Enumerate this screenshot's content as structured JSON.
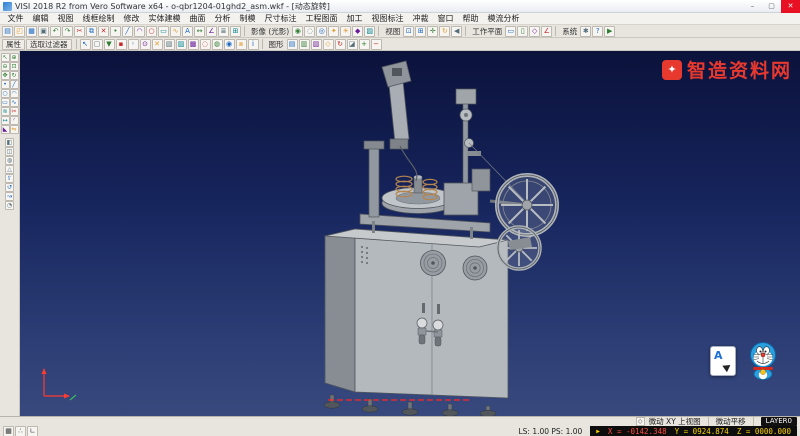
{
  "window": {
    "title": "VISI 2018 R2 from Vero Software x64 - o-qbr1204-01ghd2_asm.wkf - [动态旋转]",
    "controls": {
      "minimize": "–",
      "maximize": "▢",
      "close": "✕"
    }
  },
  "menu": {
    "items": [
      {
        "id": "file",
        "label": "文件"
      },
      {
        "id": "edit",
        "label": "编辑"
      },
      {
        "id": "view",
        "label": "视图"
      },
      {
        "id": "wireframe",
        "label": "线框绘制"
      },
      {
        "id": "modify",
        "label": "修改"
      },
      {
        "id": "solid",
        "label": "实体建模"
      },
      {
        "id": "surface",
        "label": "曲面"
      },
      {
        "id": "analysis",
        "label": "分析"
      },
      {
        "id": "mould",
        "label": "制模"
      },
      {
        "id": "dimension",
        "label": "尺寸标注"
      },
      {
        "id": "drawing",
        "label": "工程图面"
      },
      {
        "id": "machining",
        "label": "加工"
      },
      {
        "id": "view-annotation",
        "label": "视图标注"
      },
      {
        "id": "blanking",
        "label": "冲裁"
      },
      {
        "id": "window",
        "label": "窗口"
      },
      {
        "id": "help",
        "label": "帮助"
      },
      {
        "id": "flow-analysis",
        "label": "模流分析"
      }
    ]
  },
  "toolbar_main": {
    "icons": [
      {
        "name": "new-file",
        "glyph": "▤",
        "fg": "#1565c0"
      },
      {
        "name": "open-file",
        "glyph": "◰",
        "fg": "#e09a2f"
      },
      {
        "name": "save-file",
        "glyph": "▦",
        "fg": "#1565c0"
      },
      {
        "name": "print",
        "glyph": "▣",
        "fg": "#546e7a"
      },
      {
        "name": "undo",
        "glyph": "↶",
        "fg": "#2e7d32"
      },
      {
        "name": "redo",
        "glyph": "↷",
        "fg": "#2e7d32"
      },
      {
        "name": "cut",
        "glyph": "✂",
        "fg": "#c62828"
      },
      {
        "name": "copy",
        "glyph": "⧉",
        "fg": "#1565c0"
      },
      {
        "name": "delete",
        "glyph": "✕",
        "fg": "#c62828"
      },
      {
        "name": "point",
        "glyph": "•",
        "fg": "#2e7d32"
      },
      {
        "name": "line",
        "glyph": "╱",
        "fg": "#1565c0"
      },
      {
        "name": "arc",
        "glyph": "◠",
        "fg": "#6a1b9a"
      },
      {
        "name": "circle",
        "glyph": "○",
        "fg": "#c62828"
      },
      {
        "name": "rectangle",
        "glyph": "▭",
        "fg": "#00838f"
      },
      {
        "name": "curve",
        "glyph": "∿",
        "fg": "#e09a2f"
      },
      {
        "name": "text",
        "glyph": "A",
        "fg": "#1565c0"
      },
      {
        "name": "dimension",
        "glyph": "↔",
        "fg": "#2e7d32"
      },
      {
        "name": "angle-measure",
        "glyph": "∠",
        "fg": "#6a1b9a"
      },
      {
        "name": "layers",
        "glyph": "≣",
        "fg": "#546e7a"
      },
      {
        "name": "grid",
        "glyph": "⊞",
        "fg": "#00838f"
      }
    ],
    "groups": [
      {
        "id": "shading",
        "label": "影像 (光影)",
        "icons": [
          {
            "name": "shaded-view",
            "glyph": "◉",
            "fg": "#2e7d32"
          },
          {
            "name": "wireframe-view",
            "glyph": "◌",
            "fg": "#546e7a"
          },
          {
            "name": "hidden-line-view",
            "glyph": "◎",
            "fg": "#1565c0"
          },
          {
            "name": "render",
            "glyph": "✦",
            "fg": "#e09a2f"
          },
          {
            "name": "lighting",
            "glyph": "☀",
            "fg": "#e09a2f"
          },
          {
            "name": "materials",
            "glyph": "◆",
            "fg": "#6a1b9a"
          },
          {
            "name": "transparency",
            "glyph": "▨",
            "fg": "#00838f"
          }
        ]
      },
      {
        "id": "view",
        "label": "视图",
        "icons": [
          {
            "name": "zoom-fit",
            "glyph": "⊡",
            "fg": "#1565c0"
          },
          {
            "name": "zoom-window",
            "glyph": "⊞",
            "fg": "#1565c0"
          },
          {
            "name": "pan",
            "glyph": "✛",
            "fg": "#2e7d32"
          },
          {
            "name": "rotate-view",
            "glyph": "↻",
            "fg": "#e09a2f"
          },
          {
            "name": "previous-view",
            "glyph": "◀",
            "fg": "#546e7a"
          }
        ]
      },
      {
        "id": "workplane",
        "label": "工作平面",
        "icons": [
          {
            "name": "workplane-xy",
            "glyph": "▭",
            "fg": "#1565c0"
          },
          {
            "name": "workplane-yz",
            "glyph": "▯",
            "fg": "#2e7d32"
          },
          {
            "name": "workplane-iso",
            "glyph": "◇",
            "fg": "#6a1b9a"
          },
          {
            "name": "workplane-custom",
            "glyph": "∠",
            "fg": "#c62828"
          }
        ]
      },
      {
        "id": "system",
        "label": "系统",
        "icons": [
          {
            "name": "settings",
            "glyph": "✱",
            "fg": "#546e7a"
          },
          {
            "name": "help",
            "glyph": "?",
            "fg": "#1565c0"
          },
          {
            "name": "macro-run",
            "glyph": "▶",
            "fg": "#2e7d32"
          }
        ]
      }
    ]
  },
  "toolbar_second": {
    "left_labels": [
      "属性",
      "选取过滤器"
    ],
    "icons": [
      {
        "name": "select",
        "glyph": "↖",
        "fg": "#1565c0"
      },
      {
        "name": "select-window",
        "glyph": "▢",
        "fg": "#546e7a"
      },
      {
        "name": "selection-filter",
        "glyph": "▼",
        "fg": "#2e7d32"
      },
      {
        "name": "snap-endpoint",
        "glyph": "▪",
        "fg": "#c62828"
      },
      {
        "name": "snap-midpoint",
        "glyph": "◦",
        "fg": "#1565c0"
      },
      {
        "name": "snap-center",
        "glyph": "⊙",
        "fg": "#6a1b9a"
      },
      {
        "name": "snap-intersection",
        "glyph": "✕",
        "fg": "#e09a2f"
      },
      {
        "name": "filter-solids",
        "glyph": "▧",
        "fg": "#546e7a"
      },
      {
        "name": "filter-surfaces",
        "glyph": "▨",
        "fg": "#00838f"
      },
      {
        "name": "filter-wireframe",
        "glyph": "▩",
        "fg": "#6a1b9a"
      },
      {
        "name": "hide-entity",
        "glyph": "◌",
        "fg": "#c62828"
      },
      {
        "name": "show-all",
        "glyph": "◍",
        "fg": "#2e7d32"
      },
      {
        "name": "isolate",
        "glyph": "◉",
        "fg": "#1565c0"
      },
      {
        "name": "group-entities",
        "glyph": "⧈",
        "fg": "#e09a2f"
      },
      {
        "name": "entity-properties",
        "glyph": "i",
        "fg": "#1565c0"
      }
    ],
    "group_label": "图形",
    "icons2": [
      {
        "name": "view-top",
        "glyph": "▤",
        "fg": "#1565c0"
      },
      {
        "name": "view-front",
        "glyph": "▥",
        "fg": "#2e7d32"
      },
      {
        "name": "view-side",
        "glyph": "▨",
        "fg": "#6a1b9a"
      },
      {
        "name": "view-isometric",
        "glyph": "◇",
        "fg": "#e09a2f"
      },
      {
        "name": "dynamic-rotate",
        "glyph": "↻",
        "fg": "#c62828"
      },
      {
        "name": "section-view",
        "glyph": "◪",
        "fg": "#546e7a"
      },
      {
        "name": "zoom-in",
        "glyph": "+",
        "fg": "#2e7d32"
      },
      {
        "name": "zoom-out",
        "glyph": "−",
        "fg": "#c62828"
      }
    ]
  },
  "sidebar": {
    "grid_icons": [
      {
        "name": "select-tool",
        "glyph": "↖",
        "fg": "#2e7d32"
      },
      {
        "name": "zoom-in-tool",
        "glyph": "⊕",
        "fg": "#2e7d32"
      },
      {
        "name": "zoom-out-tool",
        "glyph": "⊖",
        "fg": "#2e7d32"
      },
      {
        "name": "zoom-fit-tool",
        "glyph": "⊡",
        "fg": "#2e7d32"
      },
      {
        "name": "pan-tool",
        "glyph": "✥",
        "fg": "#2e7d32"
      },
      {
        "name": "rotate-tool",
        "glyph": "↻",
        "fg": "#2e7d32"
      },
      {
        "name": "point-tool",
        "glyph": "•",
        "fg": "#1565c0"
      },
      {
        "name": "line-tool",
        "glyph": "╱",
        "fg": "#1565c0"
      },
      {
        "name": "circle-tool",
        "glyph": "○",
        "fg": "#1565c0"
      },
      {
        "name": "arc-tool",
        "glyph": "◠",
        "fg": "#1565c0"
      },
      {
        "name": "rectangle-tool",
        "glyph": "▭",
        "fg": "#1565c0"
      },
      {
        "name": "spline-tool",
        "glyph": "∿",
        "fg": "#1565c0"
      },
      {
        "name": "offset-tool",
        "glyph": "≋",
        "fg": "#00838f"
      },
      {
        "name": "trim-tool",
        "glyph": "✂",
        "fg": "#c62828"
      },
      {
        "name": "extend-tool",
        "glyph": "↦",
        "fg": "#00838f"
      },
      {
        "name": "fillet-tool",
        "glyph": "◜",
        "fg": "#6a1b9a"
      },
      {
        "name": "chamfer-tool",
        "glyph": "◣",
        "fg": "#6a1b9a"
      },
      {
        "name": "mirror-tool",
        "glyph": "⇋",
        "fg": "#e09a2f"
      }
    ],
    "column_icons": [
      {
        "name": "solid-box",
        "glyph": "◧",
        "fg": "#546e7a"
      },
      {
        "name": "solid-cylinder",
        "glyph": "◫",
        "fg": "#546e7a"
      },
      {
        "name": "solid-sphere",
        "glyph": "◍",
        "fg": "#546e7a"
      },
      {
        "name": "solid-cone",
        "glyph": "△",
        "fg": "#546e7a"
      },
      {
        "name": "extrude",
        "glyph": "⇧",
        "fg": "#1565c0"
      },
      {
        "name": "revolve",
        "glyph": "↺",
        "fg": "#1565c0"
      },
      {
        "name": "sweep",
        "glyph": "↝",
        "fg": "#1565c0"
      },
      {
        "name": "shell",
        "glyph": "◔",
        "fg": "#546e7a"
      }
    ]
  },
  "viewport": {
    "watermark": {
      "logo_glyph": "✦",
      "text": "智造资料网",
      "color": "#e8392f"
    }
  },
  "popup": {
    "letter": "A"
  },
  "status_top": {
    "view_mode": "微动 XY 上视图",
    "pan_mode": "微动平移",
    "layer_badge": "LAYER0"
  },
  "status_bottom": {
    "icons": [
      {
        "name": "grid-toggle",
        "glyph": "▦"
      },
      {
        "name": "snap-toggle",
        "glyph": "∴"
      },
      {
        "name": "ortho-toggle",
        "glyph": "∟"
      }
    ],
    "scale": "LS: 1.00 PS: 1.00",
    "coords": {
      "caret": "▶",
      "x": "X = -0142.348",
      "y": "Y = 0924.874",
      "z": "Z = 0000.000"
    }
  },
  "colors": {
    "viewport_top": "#0b123b",
    "viewport_bottom": "#38497e",
    "watermark_red": "#e8392f",
    "coord_yellow": "#ffd400",
    "coord_x_red": "#ff4b3a"
  }
}
